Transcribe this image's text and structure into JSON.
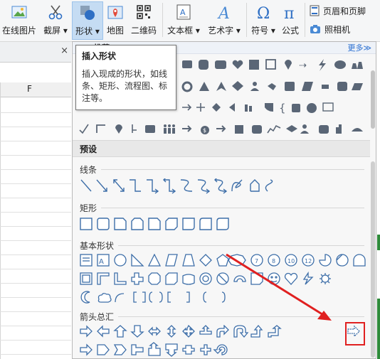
{
  "ribbon": {
    "buttons": [
      {
        "label": "在线图片"
      },
      {
        "label": "截屏 ▾"
      },
      {
        "label": "形状 ▾"
      },
      {
        "label": "地图"
      },
      {
        "label": "二维码"
      },
      {
        "label": "文本框 ▾"
      },
      {
        "label": "艺术字 ▾"
      },
      {
        "label": "符号 ▾"
      },
      {
        "label": "公式"
      }
    ],
    "header_footer": "页眉和页脚",
    "camera": "照相机"
  },
  "sheet": {
    "column_label": "F"
  },
  "doc_tab": {
    "close": "×"
  },
  "shape_panel": {
    "more_link": "更多≫",
    "recommended": "推荐",
    "preset_header": "预设",
    "sections": {
      "lines": "线条",
      "rectangles": "矩形",
      "basic_shapes": "基本形状",
      "block_arrows": "箭头总汇"
    }
  },
  "tooltip": {
    "title": "插入形状",
    "body": "插入现成的形状，如线条、矩形、流程图、标注等。"
  },
  "colors": {
    "accent": "#2e6fc4",
    "active_bg": "#c5dcf3",
    "annotation_red": "#e02020"
  }
}
